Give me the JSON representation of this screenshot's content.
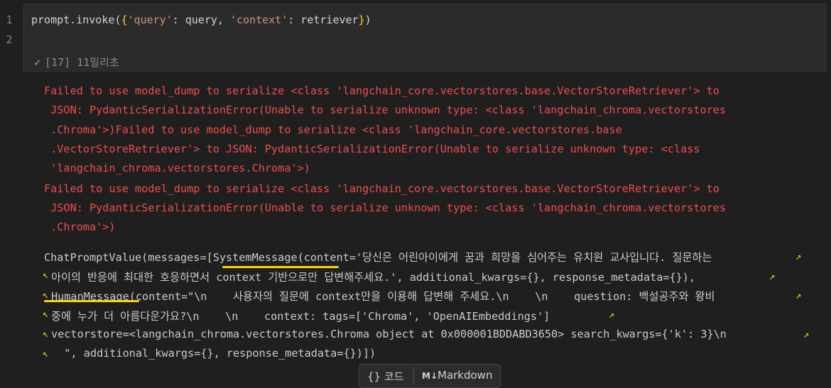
{
  "editor": {
    "line_numbers": [
      "1",
      "2"
    ],
    "code": {
      "t1": "prompt.invoke(",
      "t2": "{",
      "t3": "'query'",
      "t4": ": query, ",
      "t5": "'context'",
      "t6": ": retriever",
      "t7": "}",
      "t8": ")"
    }
  },
  "status": {
    "exec_count": "[17]",
    "duration": "11밀리초"
  },
  "output": {
    "errors": [
      "Failed to use model_dump to serialize <class 'langchain_core.vectorstores.base.VectorStoreRetriever'> to",
      " JSON: PydanticSerializationError(Unable to serialize unknown type: <class 'langchain_chroma.vectorstores",
      " .Chroma'>)Failed to use model_dump to serialize <class 'langchain_core.vectorstores.base",
      " .VectorStoreRetriever'> to JSON: PydanticSerializationError(Unable to serialize unknown type: <class",
      " 'langchain_chroma.vectorstores.Chroma'>)",
      "Failed to use model_dump to serialize <class 'langchain_core.vectorstores.base.VectorStoreRetriever'> to",
      " JSON: PydanticSerializationError(Unable to serialize unknown type: <class 'langchain_chroma.vectorstores",
      " .Chroma'>)"
    ],
    "result": [
      "ChatPromptValue(messages=[SystemMessage(content='당신은 어린아이에게 꿈과 희망을 심어주는 유치원 교사입니다. 질문하는",
      "아이의 반응에 최대한 호응하면서 context 기반으로만 답변해주세요.', additional_kwargs={}, response_metadata={}),",
      "HumanMessage(content=\"\\n    사용자의 질문에 context만을 이용해 답변해 주세요.\\n    \\n    question: 백설공주와 왕비",
      "중에 누가 더 아름다운가요?\\n    \\n    context: tags=['Chroma', 'OpenAIEmbeddings']",
      "vectorstore=<langchain_chroma.vectorstores.Chroma object at 0x000001BDDABD3650> search_kwargs={'k': 3}\\n",
      "  \", additional_kwargs={}, response_metadata={})])"
    ]
  },
  "toolbar": {
    "code_icon": "{}",
    "code_label": "코드",
    "markdown_icon": "M↓",
    "markdown_label": "Markdown"
  }
}
